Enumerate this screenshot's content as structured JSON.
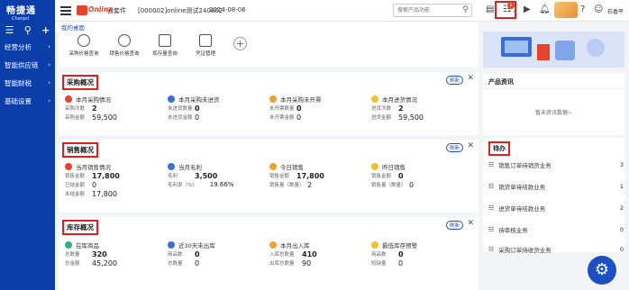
{
  "sidebar": {
    "logo_cn": "畅捷通",
    "logo_en": "Chanjet",
    "items": [
      {
        "label": "经营分析"
      },
      {
        "label": "智能供应链"
      },
      {
        "label": "智能财税"
      },
      {
        "label": "基础设置"
      }
    ]
  },
  "topbar": {
    "brand_online": "Online",
    "brand_text": "云套件",
    "account": "[000002]online测试240802",
    "date": "2024-08-06",
    "search_placeholder": "搜索产品功能",
    "notification_count": "1",
    "user": "石香平"
  },
  "tabs": {
    "active": "我的桌面"
  },
  "quick_actions": [
    {
      "label": "采购价格查询"
    },
    {
      "label": "销售价格查询"
    },
    {
      "label": "现存量查询"
    },
    {
      "label": "凭证管理"
    }
  ],
  "refresh_label": "刷新",
  "purchase": {
    "title": "采购概况",
    "blocks": [
      {
        "head": "本月采购情况",
        "rows": [
          {
            "k": "采购次数",
            "v": "2"
          },
          {
            "k": "采购金额",
            "v": "59,500"
          }
        ]
      },
      {
        "head": "本月采购未进货",
        "rows": [
          {
            "k": "未进货数量",
            "v": "0"
          },
          {
            "k": "未进货金额",
            "v": "0"
          }
        ]
      },
      {
        "head": "本月采购未开票",
        "rows": [
          {
            "k": "未开票数量",
            "v": "0"
          },
          {
            "k": "未开票金额",
            "v": "0"
          }
        ]
      },
      {
        "head": "本月进货情况",
        "rows": [
          {
            "k": "进货次数",
            "v": "2"
          },
          {
            "k": "进货金额",
            "v": "59,500"
          }
        ]
      }
    ]
  },
  "sales": {
    "title": "销售概况",
    "b1": {
      "head": "当月销售情况",
      "rows": [
        {
          "k": "销售金额",
          "v": "17,800"
        },
        {
          "k": "已结金额",
          "v": "0"
        },
        {
          "k": "未结金额",
          "v": "17,800"
        }
      ]
    },
    "b2": {
      "head": "当月毛利",
      "r1k": "毛利",
      "r1v": "3,500",
      "r2k": "毛利率（%）",
      "r2v": "19.66%"
    },
    "b3": {
      "head": "今日销售",
      "r1k": "销售金额",
      "r1v": "17,800",
      "r2k": "销售量（数量）",
      "r2v": "2"
    },
    "b4": {
      "head": "昨日销售",
      "r1k": "销售金额",
      "r1v": "0",
      "r2k": "销售量（数量）",
      "r2v": "0"
    }
  },
  "stock": {
    "title": "库存概况",
    "blocks": [
      {
        "head": "在库商品",
        "rows": [
          {
            "k": "总数量",
            "v": "320"
          },
          {
            "k": "总金额",
            "v": "45,200"
          }
        ]
      },
      {
        "head": "近30天未出库",
        "rows": [
          {
            "k": "商品数",
            "v": "0"
          },
          {
            "k": "总数量",
            "v": "0"
          }
        ]
      },
      {
        "head": "本月出入库",
        "rows": [
          {
            "k": "入库总数量",
            "v": "410"
          },
          {
            "k": "出库总数量",
            "v": "90"
          }
        ]
      },
      {
        "head": "最低库存预警",
        "rows": [
          {
            "k": "商品数",
            "v": "0"
          },
          {
            "k": "短缺量",
            "v": "0"
          }
        ]
      }
    ]
  },
  "news": {
    "title": "产品资讯",
    "empty": "暂未资讯数据~"
  },
  "todo": {
    "title": "待办",
    "items": [
      {
        "label": "销售订单待销货业务",
        "count": "3"
      },
      {
        "label": "销货单待结款业务",
        "count": "1"
      },
      {
        "label": "进货单待结款业务",
        "count": "2"
      },
      {
        "label": "待审核业务",
        "count": "0"
      },
      {
        "label": "采购订单待收货业务",
        "count": "0"
      }
    ]
  },
  "colors": {
    "sidebar": "#0b3ea8",
    "accent": "#1d4fc4",
    "highlight_border": "#e02020",
    "purchase_dot": "#e8422c",
    "blue_dot": "#3b6fd8",
    "orange_dot": "#f0a030",
    "yellow_dot": "#f0c030",
    "green_dot": "#2bb673"
  }
}
